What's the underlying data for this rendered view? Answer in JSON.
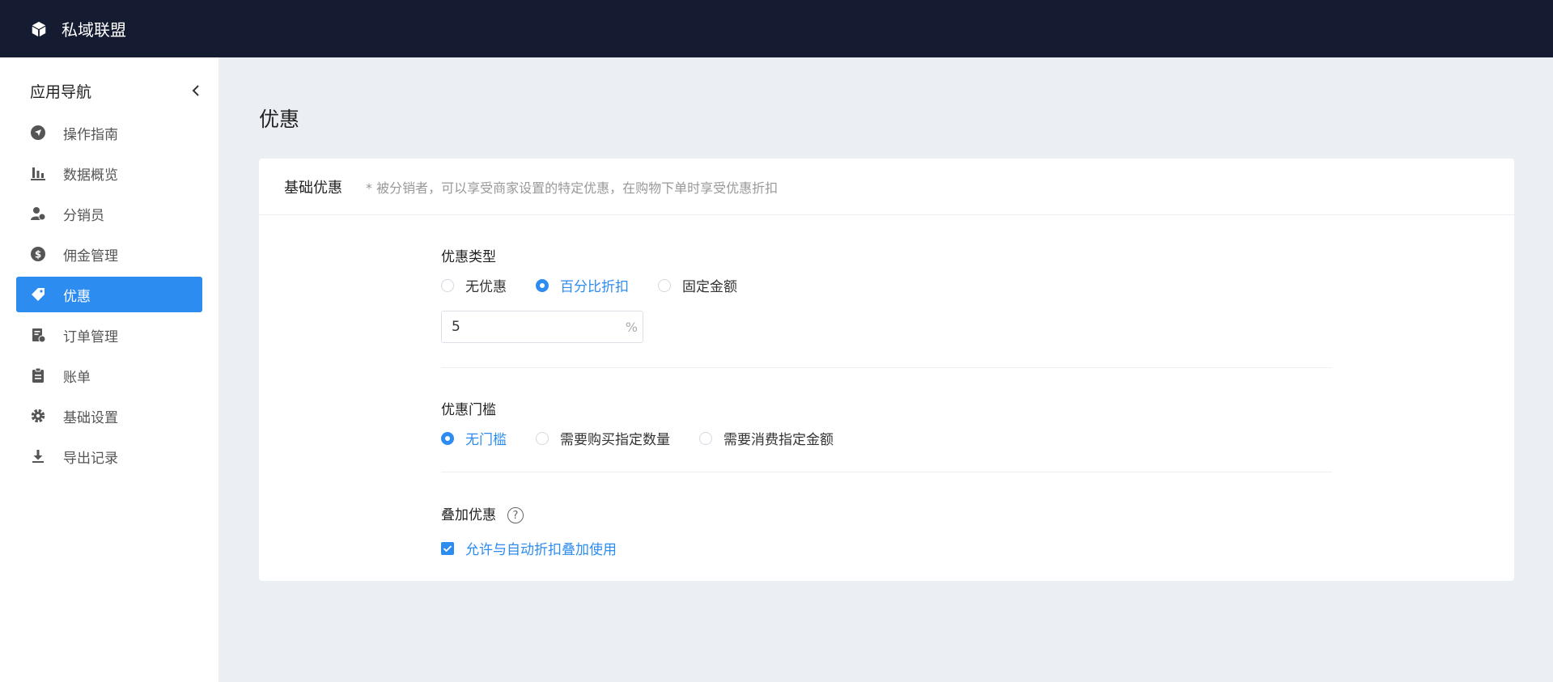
{
  "app": {
    "brand": "私域联盟"
  },
  "sidebar": {
    "title": "应用导航",
    "items": [
      {
        "label": "操作指南",
        "icon": "navigation-icon"
      },
      {
        "label": "数据概览",
        "icon": "bar-chart-icon"
      },
      {
        "label": "分销员",
        "icon": "distributor-icon"
      },
      {
        "label": "佣金管理",
        "icon": "dollar-icon"
      },
      {
        "label": "优惠",
        "icon": "tag-icon",
        "active": true
      },
      {
        "label": "订单管理",
        "icon": "order-icon"
      },
      {
        "label": "账单",
        "icon": "clipboard-icon"
      },
      {
        "label": "基础设置",
        "icon": "gear-icon"
      },
      {
        "label": "导出记录",
        "icon": "download-icon"
      }
    ]
  },
  "page": {
    "title": "优惠"
  },
  "card": {
    "title": "基础优惠",
    "description": "* 被分销者，可以享受商家设置的特定优惠，在购物下单时享受优惠折扣"
  },
  "discount_type": {
    "label": "优惠类型",
    "options": [
      "无优惠",
      "百分比折扣",
      "固定金额"
    ],
    "selected": "百分比折扣",
    "value": "5",
    "unit": "%"
  },
  "threshold": {
    "label": "优惠门槛",
    "options": [
      "无门槛",
      "需要购买指定数量",
      "需要消费指定金额"
    ],
    "selected": "无门槛"
  },
  "stacking": {
    "label": "叠加优惠",
    "help": "?",
    "checkbox_label": "允许与自动折扣叠加使用",
    "checked": true
  },
  "colors": {
    "topbar": "#151c31",
    "accent": "#2d8cf0",
    "background": "#ebeef3"
  }
}
